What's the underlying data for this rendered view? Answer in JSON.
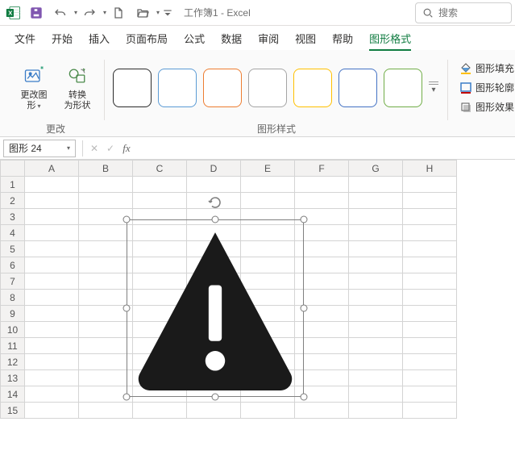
{
  "title_bar": {
    "doc_title": "工作簿1 - Excel"
  },
  "search": {
    "placeholder": "搜索"
  },
  "tabs": {
    "file": "文件",
    "home": "开始",
    "insert": "插入",
    "pagelayout": "页面布局",
    "formulas": "公式",
    "data": "数据",
    "review": "审阅",
    "view": "视图",
    "help": "帮助",
    "shapeformat": "图形格式"
  },
  "ribbon": {
    "change_group_label": "更改",
    "change_graphic": "更改图\n形",
    "convert_shape": "转换\n为形状",
    "styles_group_label": "图形样式",
    "fill": "图形填充",
    "outline": "图形轮廓",
    "effects": "图形效果",
    "style_colors": [
      "#2b2b2b",
      "#5b9bd5",
      "#ed7d31",
      "#a5a5a5",
      "#ffc000",
      "#4472c4",
      "#70ad47"
    ]
  },
  "formula_bar": {
    "name_box": "图形 24"
  },
  "grid": {
    "columns": [
      "A",
      "B",
      "C",
      "D",
      "E",
      "F",
      "G",
      "H"
    ],
    "rows": [
      1,
      2,
      3,
      4,
      5,
      6,
      7,
      8,
      9,
      10,
      11,
      12,
      13,
      14,
      15
    ]
  }
}
